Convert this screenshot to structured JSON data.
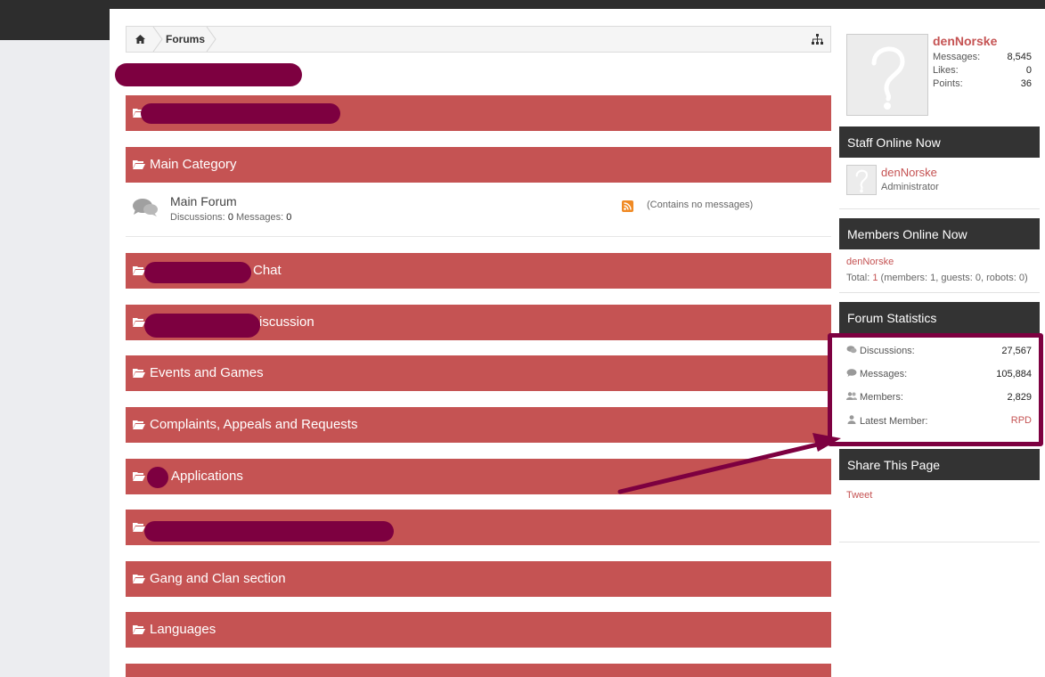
{
  "breadcrumb": {
    "forums": "Forums"
  },
  "categories": [
    {
      "label": ""
    },
    {
      "label": "Main Category"
    },
    {
      "label": "Chat"
    },
    {
      "label": "iscussion"
    },
    {
      "label": "Events and Games"
    },
    {
      "label": "Complaints, Appeals and Requests"
    },
    {
      "label": "Applications"
    },
    {
      "label": ""
    },
    {
      "label": "Gang and Clan section"
    },
    {
      "label": "Languages"
    }
  ],
  "forum": {
    "title": "Main Forum",
    "discussions_label": "Discussions:",
    "discussions": "0",
    "messages_label": "Messages:",
    "messages": "0",
    "no_messages": "(Contains no messages)"
  },
  "user": {
    "name": "denNorske",
    "messages_label": "Messages:",
    "messages": "8,545",
    "likes_label": "Likes:",
    "likes": "0",
    "points_label": "Points:",
    "points": "36"
  },
  "staff_online": {
    "title": "Staff Online Now",
    "name": "denNorske",
    "role": "Administrator"
  },
  "members_online": {
    "title": "Members Online Now",
    "member": "denNorske",
    "total_label": "Total:",
    "total": "1",
    "detail": "(members: 1, guests: 0, robots: 0)"
  },
  "forum_stats": {
    "title": "Forum Statistics",
    "discussions_label": "Discussions:",
    "discussions": "27,567",
    "messages_label": "Messages:",
    "messages": "105,884",
    "members_label": "Members:",
    "members": "2,829",
    "latest_label": "Latest Member:",
    "latest": "RPD"
  },
  "share": {
    "title": "Share This Page",
    "tweet": "Tweet"
  },
  "colors": {
    "category_bar": "#c55353",
    "accent_link": "#c55353",
    "annotation": "#7d0040",
    "sidebar_header": "#333333"
  }
}
